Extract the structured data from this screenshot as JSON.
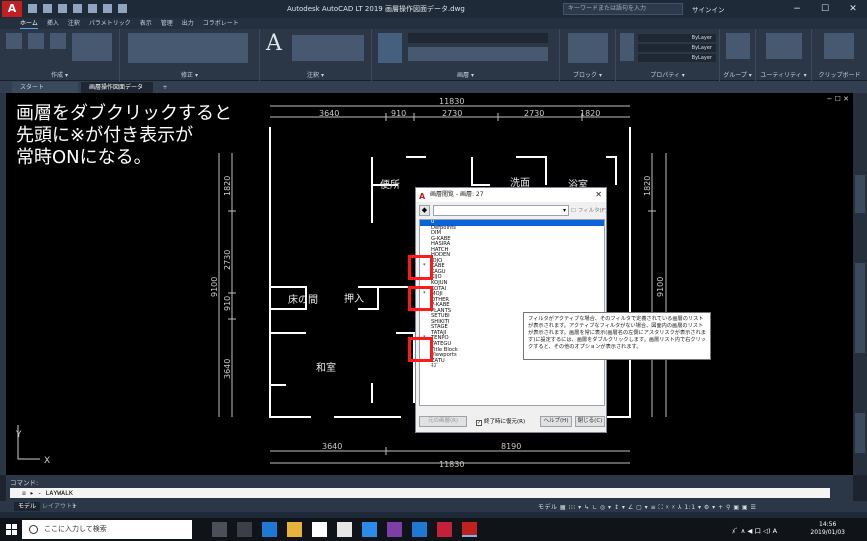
{
  "window": {
    "app_logo": "A",
    "title": "Autodesk AutoCAD LT 2019    画層操作図面データ.dwg",
    "search_placeholder": "キーワードまたは語句を入力",
    "signin": "サインイン",
    "controls": [
      "−",
      "☐",
      "✕"
    ]
  },
  "ribbon": {
    "tabs": [
      "ホーム",
      "挿入",
      "注釈",
      "パラメトリック",
      "表示",
      "管理",
      "出力",
      "コラボレート"
    ],
    "active_tab": "ホーム",
    "panels": [
      "作成 ▾",
      "修正 ▾",
      "注釈 ▾",
      "画層 ▾",
      "ブロック ▾",
      "プロパティ ▾",
      "グループ ▾",
      "ユーティリティ ▾",
      "クリップボード"
    ],
    "bylayer_1": "ByLayer",
    "bylayer_2": "ByLayer",
    "bylayer_3": "ByLayer"
  },
  "file_tabs": {
    "start": "スタート",
    "document": "画層操作図面データ*",
    "add": "+"
  },
  "canvas": {
    "window_controls": "− ☐ ✕",
    "annotation": "画層をダブクリックすると\n先頭に※が付き表示が\n常時ONになる。",
    "dims_top": {
      "total": "11830",
      "a": "3640",
      "b": "910",
      "c": "2730",
      "d": "2730",
      "e": "1820"
    },
    "dims_bottom": {
      "a": "3640",
      "b": "8190",
      "total": "11830"
    },
    "dims_left": {
      "a": "1820",
      "b": "2730",
      "c": "910",
      "d": "3640",
      "total": "9100"
    },
    "dims_right": {
      "a": "1820",
      "b": "9100"
    },
    "rooms": {
      "toilet": "便所",
      "washroom": "洗面",
      "bath": "浴室",
      "tokonoma": "床の間",
      "closet": "押入",
      "washitsu": "和室"
    },
    "ucs_y": "Y",
    "ucs_x": "X"
  },
  "layer_dialog": {
    "title": "画層閲覧 - 画層: 27",
    "close": "✕",
    "filter_checkbox": "フィルタ(F)",
    "layers": [
      {
        "name": "0",
        "star": false,
        "selected": true
      },
      {
        "name": "Defpoints",
        "star": false
      },
      {
        "name": "DIM",
        "star": false
      },
      {
        "name": "G-KABE",
        "star": false
      },
      {
        "name": "HASIRA",
        "star": false
      },
      {
        "name": "HATCH",
        "star": false
      },
      {
        "name": "HODEN",
        "star": false
      },
      {
        "name": "JOJO",
        "star": false
      },
      {
        "name": "KABE",
        "star": true
      },
      {
        "name": "KAGU",
        "star": false
      },
      {
        "name": "KIJO",
        "star": false
      },
      {
        "name": "KOJUN",
        "star": false
      },
      {
        "name": "KOTAI",
        "star": false
      },
      {
        "name": "MOJI",
        "star": true
      },
      {
        "name": "OTHER",
        "star": false
      },
      {
        "name": "P-KABE",
        "star": false
      },
      {
        "name": "PLANTS",
        "star": false
      },
      {
        "name": "SETUBI",
        "star": false
      },
      {
        "name": "SHIKITI",
        "star": false
      },
      {
        "name": "STAGE",
        "star": false
      },
      {
        "name": "TATAJI",
        "star": false
      },
      {
        "name": "TENPO",
        "star": true
      },
      {
        "name": "TATEGU",
        "star": false
      },
      {
        "name": "Title Block",
        "star": false
      },
      {
        "name": "Viewports",
        "star": false
      },
      {
        "name": "ZATU",
        "star": false
      },
      {
        "name": "ﾈｽﾞ",
        "star": false
      }
    ],
    "restore_button": "元の画層(R)",
    "restore_on_exit": "終了時に復元(R)",
    "restore_on_exit_checked": "✓",
    "help_button": "ヘルプ(H)",
    "close_button": "閉じる(C)"
  },
  "tooltip": {
    "text": "フィルタがアクティブな場合、そのフィルタで定義されている画層のリストが表示されます。アクティブなフィルタがない場合、図面内の画層のリストが表示されます。画層を常に表示(画層名の左側にアスタリスクが表示されます)に設定するには、画層をダブルクリックします。画層リスト内で右クリックすると、その他のオプションが表示されます。"
  },
  "command": {
    "header": "コマンド:",
    "input": "- LAYWALK",
    "prefix": "☒ ▸"
  },
  "statusbar": {
    "model": "モデル",
    "layout1": "レイアウト1",
    "add": "+",
    "right": "モデル ▦ ⁝⁝⁝ ▾ ↳ ∟ ◎ ▾ ↕ ▾ ∠ ▢ ▾ ≡ ⛶ ☓ ☓ ⅄ 1:1 ▾ ⚙ ▾ + ⚲ ▣ ▣ ☰"
  },
  "taskbar": {
    "search_placeholder": "ここに入力して検索",
    "tray": "ﾒﾞ ∧ ◀ 口 ◁) A",
    "time": "14:56",
    "date": "2019/01/03"
  }
}
